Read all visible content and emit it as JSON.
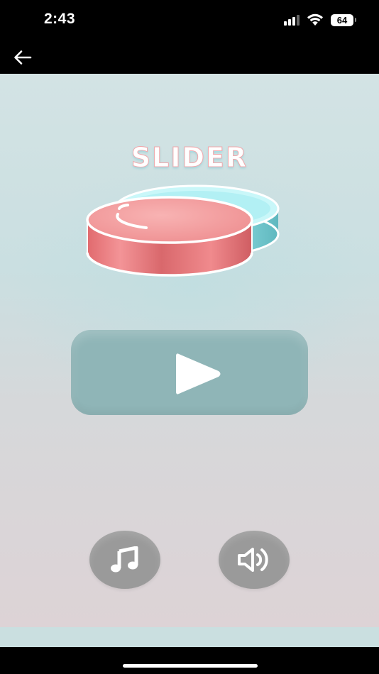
{
  "status_bar": {
    "time": "2:43",
    "battery": "64",
    "icons": [
      "signal-icon",
      "wifi-icon",
      "battery-icon"
    ]
  },
  "nav": {
    "back_icon": "arrow-left-icon"
  },
  "game": {
    "title": "SLIDER",
    "play_icon": "play-icon",
    "music_icon": "music-note-icon",
    "sound_icon": "speaker-icon"
  },
  "colors": {
    "background_top": "#d3e3e4",
    "background_bottom": "#ddd3d6",
    "play_button": "#8fb5b7",
    "round_button": "#9a9a9a",
    "puck_red": "#e8787a",
    "puck_cyan": "#a8eef2"
  }
}
